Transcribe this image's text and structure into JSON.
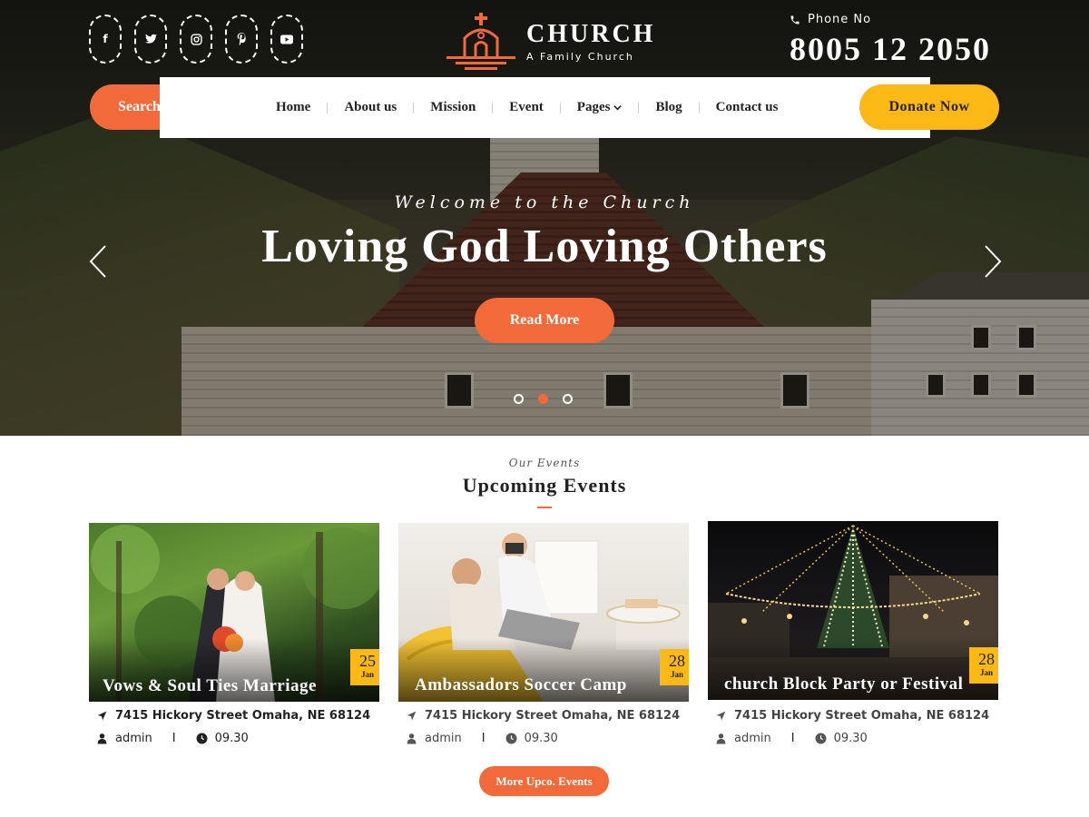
{
  "header": {
    "socials": [
      {
        "name": "facebook-icon",
        "glyph": "f"
      },
      {
        "name": "twitter-icon",
        "glyph": "t"
      },
      {
        "name": "instagram-icon",
        "glyph": "◎"
      },
      {
        "name": "pinterest-icon",
        "glyph": "P"
      },
      {
        "name": "youtube-icon",
        "glyph": "▶"
      }
    ],
    "logo": {
      "title": "CHURCH",
      "subtitle": "A Family Church"
    },
    "phone": {
      "label": "Phone No",
      "number": "8005 12 2050"
    },
    "search": {
      "label": "Search ..."
    },
    "donate_label": "Donate Now",
    "nav": [
      {
        "label": "Home"
      },
      {
        "label": "About us"
      },
      {
        "label": "Mission"
      },
      {
        "label": "Event"
      },
      {
        "label": "Pages",
        "has_dropdown": true
      },
      {
        "label": "Blog"
      },
      {
        "label": "Contact us"
      }
    ]
  },
  "hero": {
    "kicker": "Welcome to the Church",
    "title": "Loving God Loving Others",
    "button_label": "Read More",
    "slides": {
      "total": 3,
      "active_index": 1
    }
  },
  "events": {
    "kicker": "Our Events",
    "title": "Upcoming Events",
    "items": [
      {
        "title": "Vows & Soul Ties Marriage",
        "day": "25",
        "month": "Jan",
        "address": "7415 Hickory Street Omaha, NE 68124",
        "author": "admin",
        "time": "09.30"
      },
      {
        "title": "Ambassadors Soccer Camp",
        "day": "28",
        "month": "Jan",
        "address": "7415 Hickory Street Omaha, NE 68124",
        "author": "admin",
        "time": "09.30"
      },
      {
        "title": "church Block Party or Festival",
        "day": "28",
        "month": "Jan",
        "address": "7415 Hickory Street Omaha, NE 68124",
        "author": "admin",
        "time": "09.30"
      }
    ],
    "more_label": "More Upco. Events"
  },
  "colors": {
    "accent": "#f26a3a",
    "secondary": "#fcb814"
  }
}
